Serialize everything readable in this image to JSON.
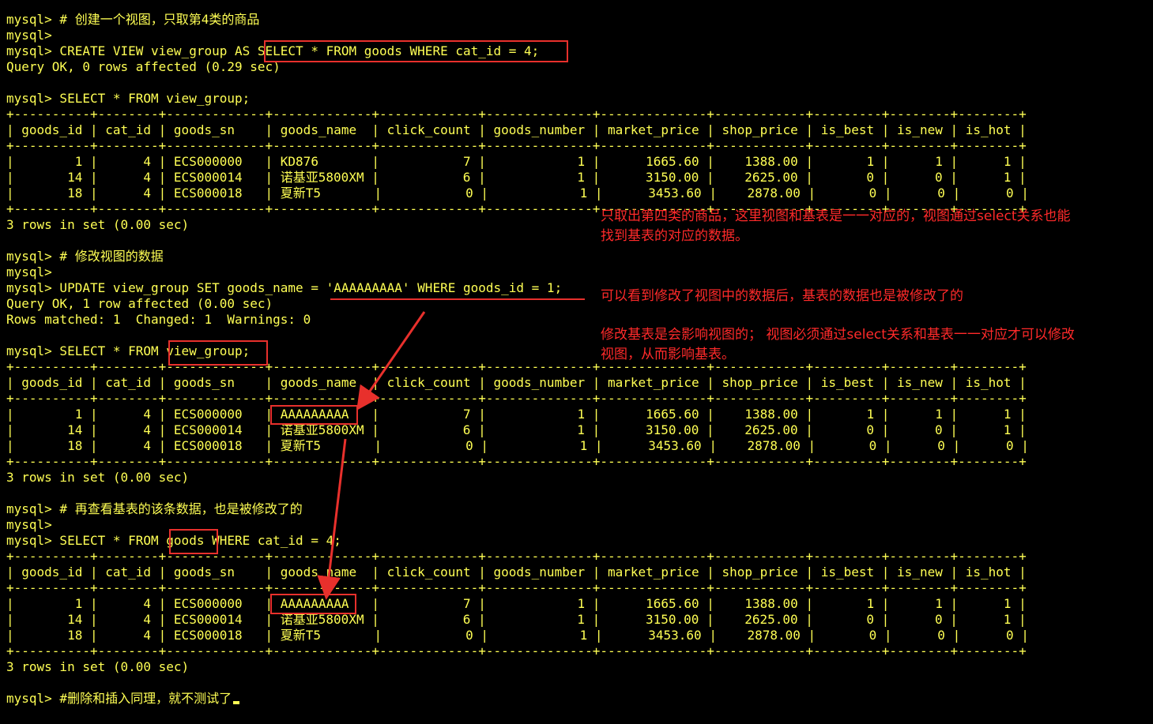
{
  "terminal": {
    "lines": [
      "mysql> # 创建一个视图，只取第4类的商品",
      "mysql>",
      "mysql> CREATE VIEW view_group AS SELECT * FROM goods WHERE cat_id = 4;",
      "Query OK, 0 rows affected (0.29 sec)",
      "",
      "mysql> SELECT * FROM view_group;",
      "+----------+--------+-------------+-------------+-------------+--------------+--------------+------------+---------+--------+--------+",
      "| goods_id | cat_id | goods_sn    | goods_name  | click_count | goods_number | market_price | shop_price | is_best | is_new | is_hot |",
      "+----------+--------+-------------+-------------+-------------+--------------+--------------+------------+---------+--------+--------+",
      "|        1 |      4 | ECS000000   | KD876       |           7 |            1 |      1665.60 |    1388.00 |       1 |      1 |      1 |",
      "|       14 |      4 | ECS000014   | 诺基亚5800XM |           6 |            1 |      3150.00 |    2625.00 |       0 |      0 |      1 |",
      "|       18 |      4 | ECS000018   | 夏新T5       |           0 |            1 |      3453.60 |    2878.00 |       0 |      0 |      0 |",
      "+----------+--------+-------------+-------------+-------------+--------------+--------------+------------+---------+--------+--------+",
      "3 rows in set (0.00 sec)",
      "",
      "mysql> # 修改视图的数据",
      "mysql>",
      "mysql> UPDATE view_group SET goods_name = 'AAAAAAAAA' WHERE goods_id = 1;",
      "Query OK, 1 row affected (0.00 sec)",
      "Rows matched: 1  Changed: 1  Warnings: 0",
      "",
      "mysql> SELECT * FROM view_group;",
      "+----------+--------+-------------+-------------+-------------+--------------+--------------+------------+---------+--------+--------+",
      "| goods_id | cat_id | goods_sn    | goods_name  | click_count | goods_number | market_price | shop_price | is_best | is_new | is_hot |",
      "+----------+--------+-------------+-------------+-------------+--------------+--------------+------------+---------+--------+--------+",
      "|        1 |      4 | ECS000000   | AAAAAAAAA   |           7 |            1 |      1665.60 |    1388.00 |       1 |      1 |      1 |",
      "|       14 |      4 | ECS000014   | 诺基亚5800XM |           6 |            1 |      3150.00 |    2625.00 |       0 |      0 |      1 |",
      "|       18 |      4 | ECS000018   | 夏新T5       |           0 |            1 |      3453.60 |    2878.00 |       0 |      0 |      0 |",
      "+----------+--------+-------------+-------------+-------------+--------------+--------------+------------+---------+--------+--------+",
      "3 rows in set (0.00 sec)",
      "",
      "mysql> # 再查看基表的该条数据，也是被修改了的",
      "mysql>",
      "mysql> SELECT * FROM goods WHERE cat_id = 4;",
      "+----------+--------+-------------+-------------+-------------+--------------+--------------+------------+---------+--------+--------+",
      "| goods_id | cat_id | goods_sn    | goods_name  | click_count | goods_number | market_price | shop_price | is_best | is_new | is_hot |",
      "+----------+--------+-------------+-------------+-------------+--------------+--------------+------------+---------+--------+--------+",
      "|        1 |      4 | ECS000000   | AAAAAAAAA   |           7 |            1 |      1665.60 |    1388.00 |       1 |      1 |      1 |",
      "|       14 |      4 | ECS000014   | 诺基亚5800XM |           6 |            1 |      3150.00 |    2625.00 |       0 |      0 |      1 |",
      "|       18 |      4 | ECS000018   | 夏新T5       |           0 |            1 |      3453.60 |    2878.00 |       0 |      0 |      0 |",
      "+----------+--------+-------------+-------------+-------------+--------------+--------------+------------+---------+--------+--------+",
      "3 rows in set (0.00 sec)",
      "",
      "mysql> #删除和插入同理，就不测试了"
    ]
  },
  "annotations": {
    "note1_line1": "只取出第四类的商品，这里视图和基表是一一对应的，视图通过select关系也能",
    "note1_line2": "找到基表的对应的数据。",
    "note2": "可以看到修改了视图中的数据后，基表的数据也是被修改了的",
    "note3_line1": "修改基表是会影响视图的； 视图必须通过select关系和基表一一对应才可以修改",
    "note3_line2": "视图，从而影响基表。"
  },
  "colors": {
    "background": "#000000",
    "terminal_text": "#ffff54",
    "annotation": "#ff2a2a"
  }
}
